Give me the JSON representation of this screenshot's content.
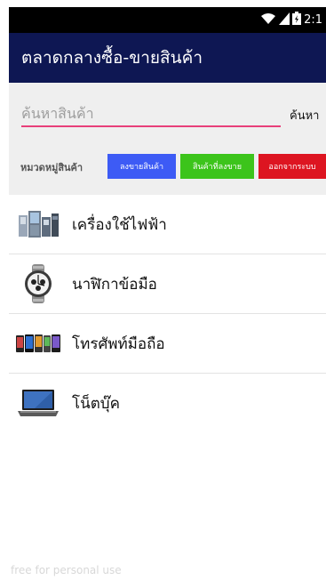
{
  "status_bar": {
    "time": "2:1",
    "icons": [
      "wifi-icon",
      "signal-icon",
      "battery-icon"
    ]
  },
  "app_bar": {
    "title": "ตลาดกลางซื้อ-ขายสินค้า"
  },
  "search": {
    "placeholder": "ค้นหาสินค้า",
    "value": "",
    "button_label": "ค้นหา"
  },
  "categories_bar": {
    "label": "หมวดหมู่สินค้า",
    "buttons": [
      {
        "label": "ลงขายสินค้า",
        "color": "#3d5bf5"
      },
      {
        "label": "สินค้าที่ลงขาย",
        "color": "#3cc41b"
      },
      {
        "label": "ออกจากระบบ",
        "color": "#dd1521"
      }
    ]
  },
  "categories": [
    {
      "label": "เครื่องใช้ไฟฟ้า",
      "icon": "appliances-icon"
    },
    {
      "label": "นาฬิกาข้อมือ",
      "icon": "wristwatch-icon"
    },
    {
      "label": "โทรศัพท์มือถือ",
      "icon": "mobile-phones-icon"
    },
    {
      "label": "โน็ตบุ๊ค",
      "icon": "laptop-icon"
    }
  ],
  "watermark": "free for personal use",
  "colors": {
    "app_bar": "#0e1753",
    "status_bar": "#000000",
    "search_underline": "#e8407a",
    "search_area_bg": "#efefef"
  }
}
